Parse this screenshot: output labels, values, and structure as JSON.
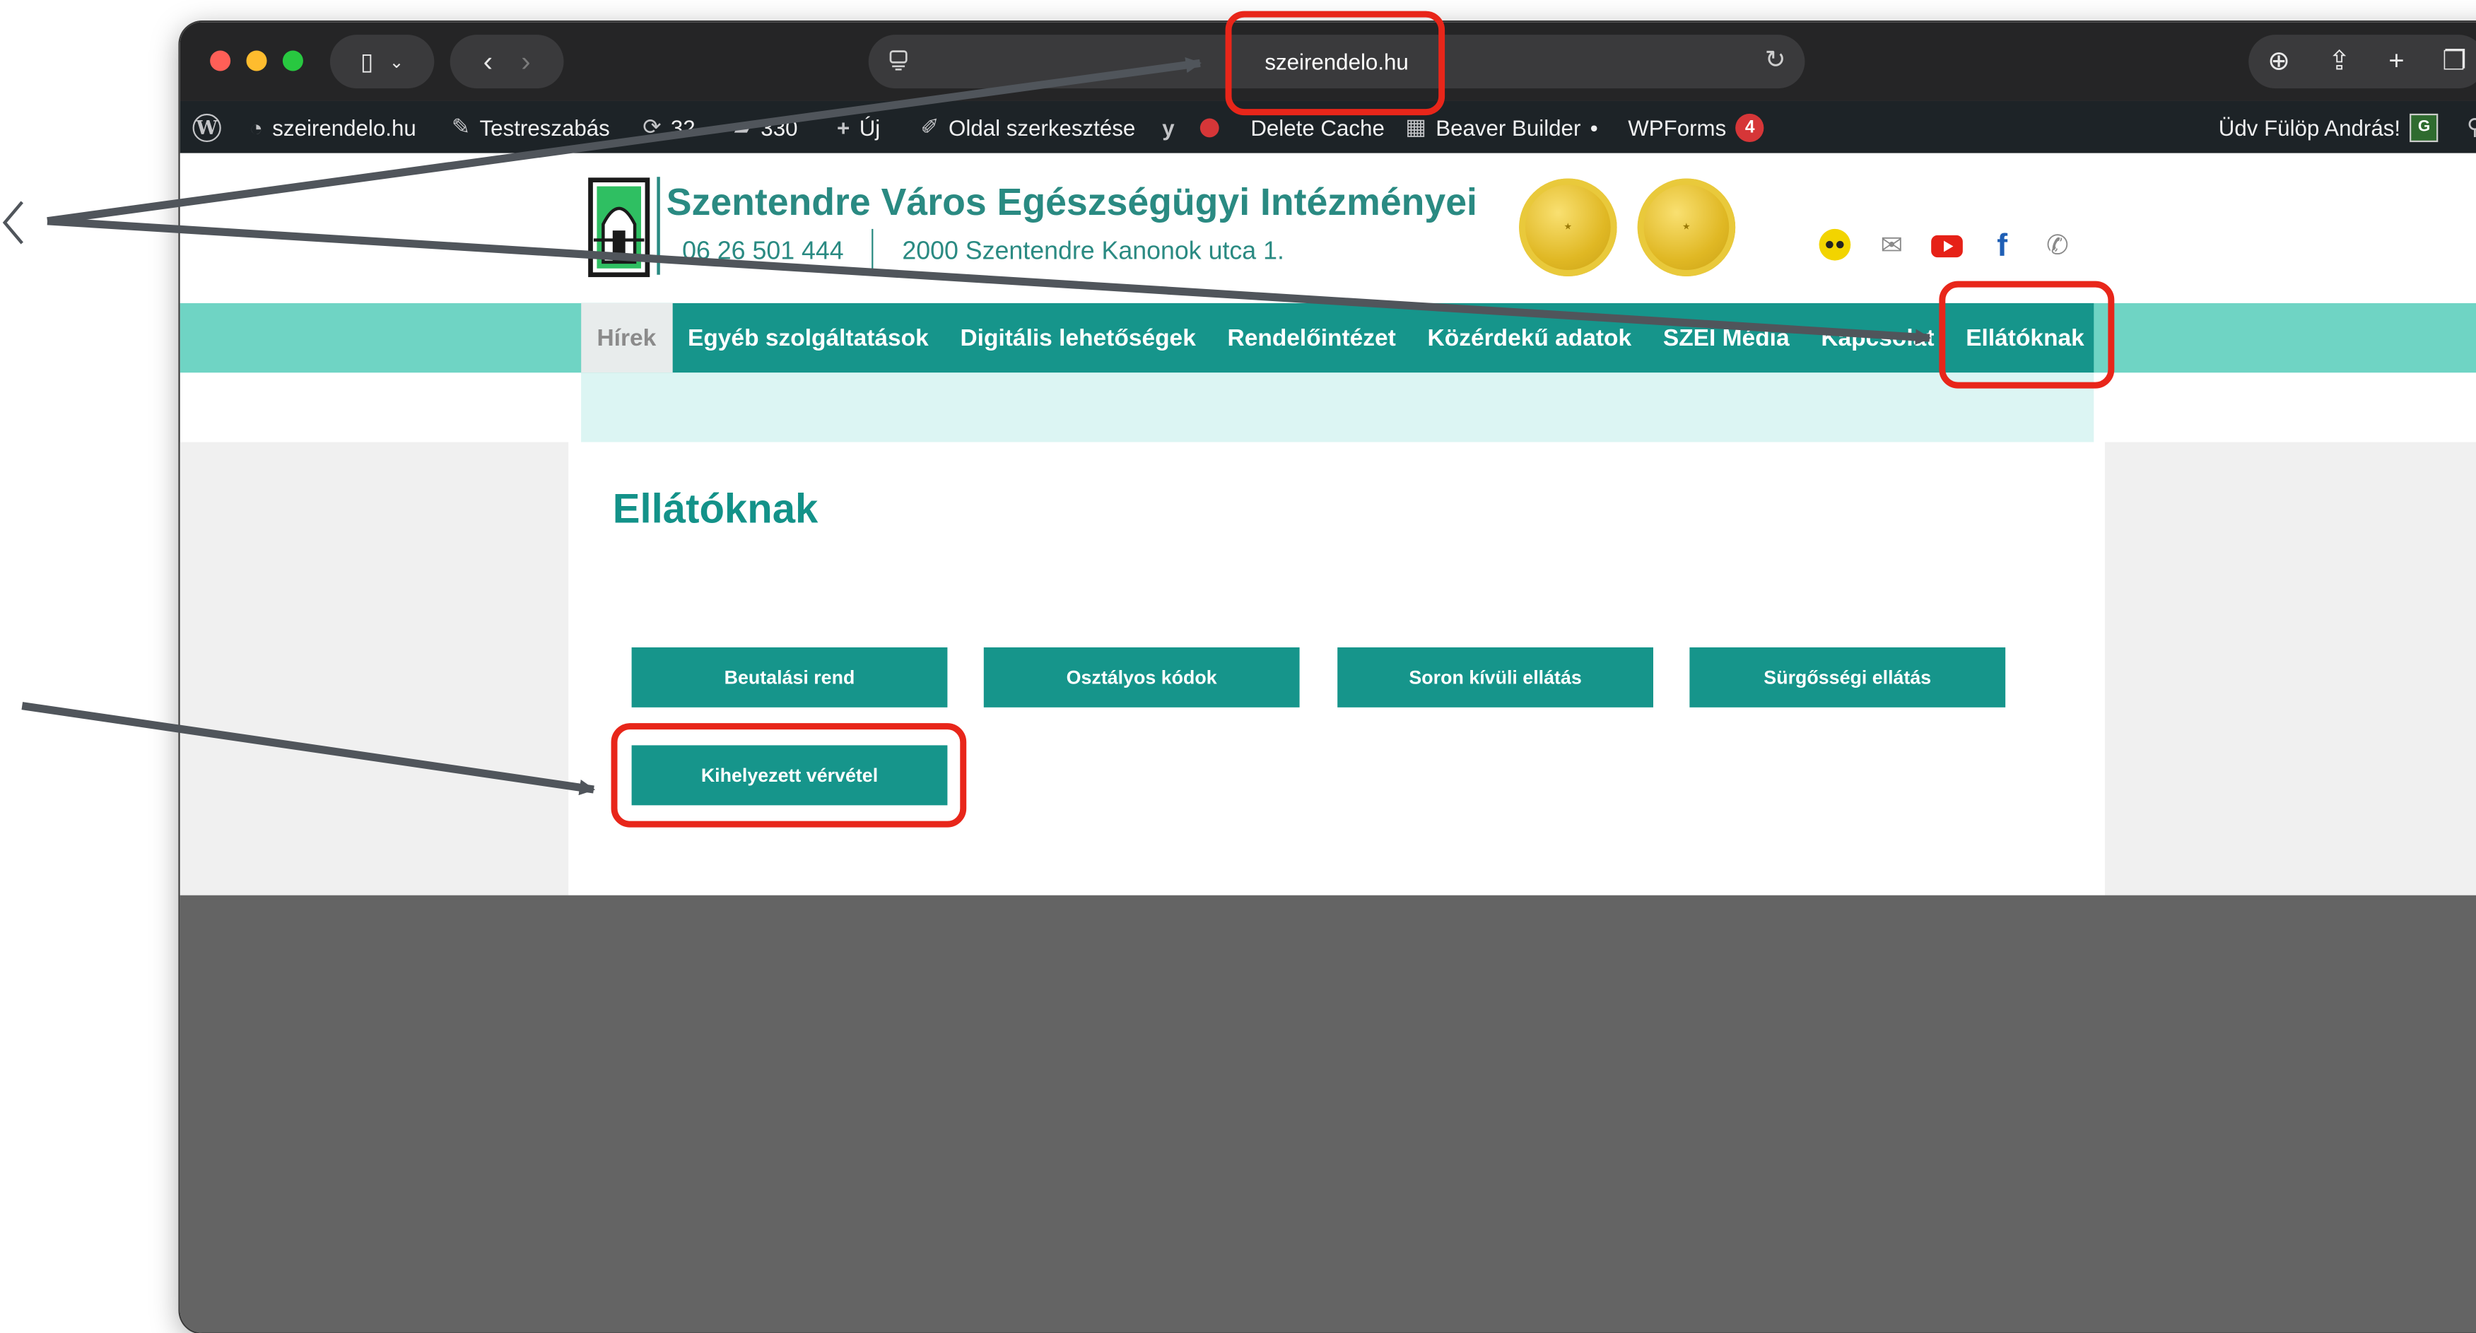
{
  "browser": {
    "url": "szeirendelo.hu"
  },
  "admin_bar": {
    "site": "szeirendelo.hu",
    "customize": "Testreszabás",
    "updates_count": "32",
    "comments_count": "330",
    "new": "Új",
    "edit_page": "Oldal szerkesztése",
    "delete_cache": "Delete Cache",
    "beaver_builder": "Beaver Builder",
    "wpforms": "WPForms",
    "wpforms_count": "4",
    "greeting": "Üdv Fülöp András!"
  },
  "header": {
    "title": "Szentendre Város Egészségügyi Intézményei",
    "phone": "06 26 501 444",
    "address": "2000 Szentendre Kanonok utca 1."
  },
  "nav": {
    "items": [
      "Hírek",
      "Egyéb szolgáltatások",
      "Digitális lehetőségek",
      "Rendelőintézet",
      "Közérdekű adatok",
      "SZEI Média",
      "Kapcsolat",
      "Ellátóknak"
    ]
  },
  "page": {
    "title": "Ellátóknak",
    "buttons": [
      "Beutalási rend",
      "Osztályos kódok",
      "Soron kívüli ellátás",
      "Sürgősségi ellátás",
      "Kihelyezett vérvétel"
    ]
  },
  "colors": {
    "accent_teal": "#16958b",
    "nav_light": "#6fd4c4",
    "annotation_red": "#e8261a",
    "footer_gray": "#646464"
  }
}
